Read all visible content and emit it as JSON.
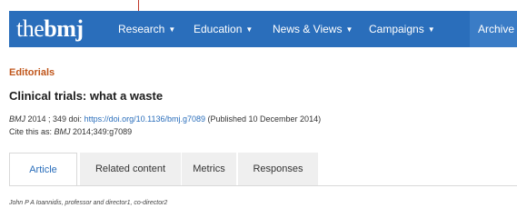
{
  "logo": {
    "prefix": "the",
    "brand": "bmj"
  },
  "nav": {
    "items": [
      {
        "label": "Research"
      },
      {
        "label": "Education"
      },
      {
        "label": "News & Views"
      },
      {
        "label": "Campaigns"
      }
    ],
    "archive_label": "Archive",
    "chevron": "▼"
  },
  "article": {
    "section": "Editorials",
    "title": "Clinical trials: what a waste",
    "citation": {
      "journal": "BMJ",
      "year_vol": " 2014 ; 349  doi: ",
      "doi_link": "https://doi.org/10.1136/bmj.g7089",
      "published": " (Published 10 December 2014)"
    },
    "cite_as": {
      "prefix": "Cite this as: ",
      "journal": "BMJ",
      "ref": " 2014;349:g7089"
    },
    "authors": "John P A Ioannidis, professor and director1, co-director2"
  },
  "tabs": [
    {
      "label": "Article",
      "active": true
    },
    {
      "label": "Related content",
      "active": false
    },
    {
      "label": "Metrics",
      "active": false
    },
    {
      "label": "Responses",
      "active": false
    }
  ],
  "colors": {
    "brand_blue": "#2a6ebb",
    "section_orange": "#c0561b"
  }
}
